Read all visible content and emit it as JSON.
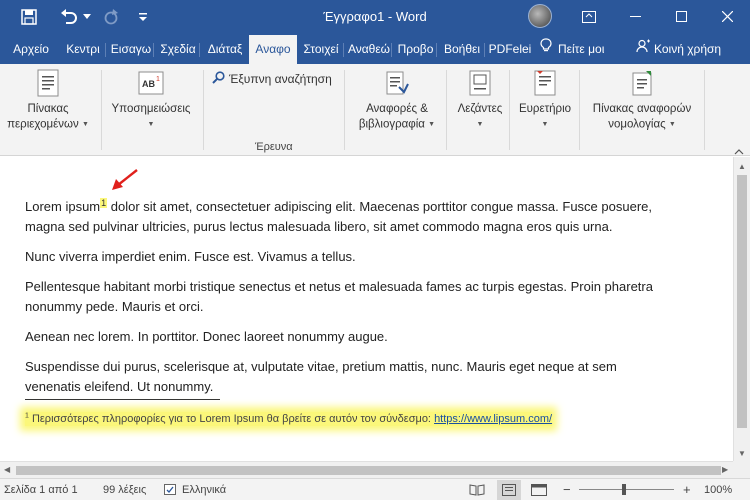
{
  "titlebar": {
    "title": "Έγγραφο1 - Word"
  },
  "tabs": [
    {
      "label": "Αρχείο",
      "active": false
    },
    {
      "label": "Κεντρι",
      "active": false
    },
    {
      "label": "Εισαγω",
      "active": false
    },
    {
      "label": "Σχεδία",
      "active": false
    },
    {
      "label": "Διάταξ",
      "active": false
    },
    {
      "label": "Αναφο",
      "active": true
    },
    {
      "label": "Στοιχεί",
      "active": false
    },
    {
      "label": "Αναθεώ",
      "active": false
    },
    {
      "label": "Προβο",
      "active": false
    },
    {
      "label": "Βοήθει",
      "active": false
    },
    {
      "label": "PDFelei",
      "active": false
    },
    {
      "label": "Πείτε μοι",
      "active": false
    },
    {
      "label": "Κοινή χρήση",
      "active": false
    }
  ],
  "ribbon": {
    "toc": [
      "Πίνακας",
      "περιεχομένων"
    ],
    "footnotes": "Υποσημειώσεις",
    "smart_lookup": "Έξυπνη αναζήτηση",
    "research_group": "Έρευνα",
    "citations": [
      "Αναφορές &",
      "βιβλιογραφία"
    ],
    "captions": "Λεζάντες",
    "index": "Ευρετήριο",
    "authorities": [
      "Πίνακας αναφορών",
      "νομολογίας"
    ],
    "footnote_icon_text": "AB",
    "footnote_icon_sup": "1"
  },
  "document": {
    "p1_before": "Lorem ipsum",
    "p1_ref": "1",
    "p1_after": " dolor sit amet, consectetuer adipiscing elit. Maecenas porttitor congue massa. Fusce posuere, magna sed pulvinar ultricies, purus lectus malesuada libero, sit amet commodo magna eros quis urna.",
    "p2": "Nunc viverra imperdiet enim. Fusce est. Vivamus a tellus.",
    "p3": "Pellentesque habitant morbi tristique senectus et netus et malesuada fames ac turpis egestas. Proin pharetra nonummy pede. Mauris et orci.",
    "p4": "Aenean nec lorem. In porttitor. Donec laoreet nonummy augue.",
    "p5": "Suspendisse dui purus, scelerisque at, vulputate vitae, pretium mattis, nunc. Mauris eget neque at sem venenatis eleifend. Ut nonummy.",
    "footnote_num": "1",
    "footnote_text": " Περισσότερες πληροφορίες για το Lorem Ipsum θα βρείτε σε αυτόν τον σύνδεσμο: ",
    "footnote_link": "https://www.lipsum.com/"
  },
  "status": {
    "page": "Σελίδα 1 από 1",
    "words": "99 λέξεις",
    "language": "Ελληνικά",
    "zoom_minus": "−",
    "zoom_plus": "+",
    "zoom": "100%"
  },
  "colors": {
    "accent": "#2b579a",
    "highlight": "#fbf77a",
    "arrow": "#e0201c"
  }
}
